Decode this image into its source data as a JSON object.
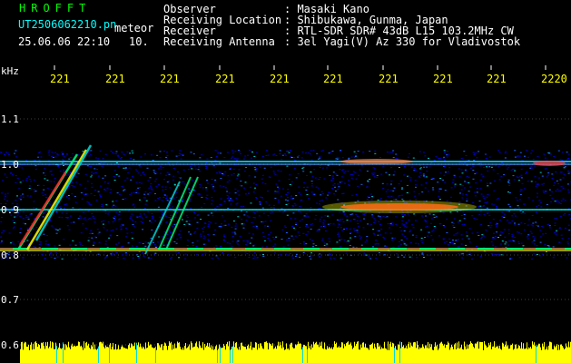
{
  "brand": "HROFFT",
  "file_name": "UT2506062210.pn",
  "meteor_label": "meteor",
  "datetime": "25.06.06 22:10",
  "interval": "10.",
  "info": {
    "observer_label": "Observer",
    "observer_value": ": Masaki Kano",
    "location_label": "Receiving Location",
    "location_value": ": Shibukawa, Gunma, Japan",
    "receiver_label": "Receiver",
    "receiver_value": ": RTL-SDR SDR# 43dB L15 103.2MHz CW",
    "antenna_label": "Receiving Antenna",
    "antenna_value": ": 3el Yagi(V) Az 330 for Vladivostok"
  },
  "y_unit": "kHz",
  "time_ticks": [
    "221",
    "221",
    "221",
    "221",
    "221",
    "221",
    "221",
    "221",
    "221",
    "2220"
  ],
  "freq_ticks": [
    "1.1",
    "1.0",
    "0.9",
    "0.8",
    "0.7",
    "0.6"
  ],
  "colors": {
    "background": "#000000",
    "brand": "#00ff00",
    "filename": "#00ffff",
    "info_text": "#ffffff",
    "time_ticks": "#ffff00",
    "noise_floor": "#0000c8",
    "signal_hot": "#ff2020",
    "amplitude_bar": "#ffff00"
  }
}
